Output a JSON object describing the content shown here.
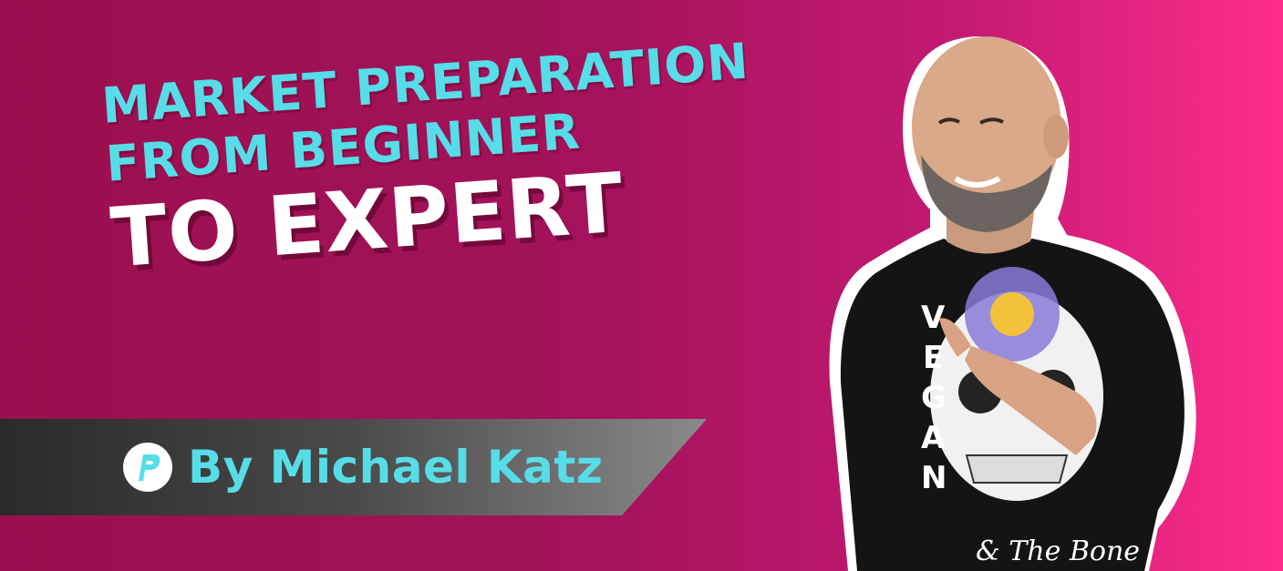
{
  "headline": {
    "line1": "MARKET PREPARATION",
    "line2": "FROM BEGINNER",
    "line3": "TO EXPERT"
  },
  "byline": {
    "text": "By Michael Katz",
    "logo_icon": "p-logo-icon"
  },
  "presenter": {
    "shirt_text": "VEGAN",
    "shirt_text_2": "& The Bone"
  },
  "colors": {
    "accent_cyan": "#56dde8",
    "background_start": "#9b1050",
    "background_end": "#ff2d8c",
    "band_dark": "#2a2a2a",
    "shirt": "#141414"
  }
}
